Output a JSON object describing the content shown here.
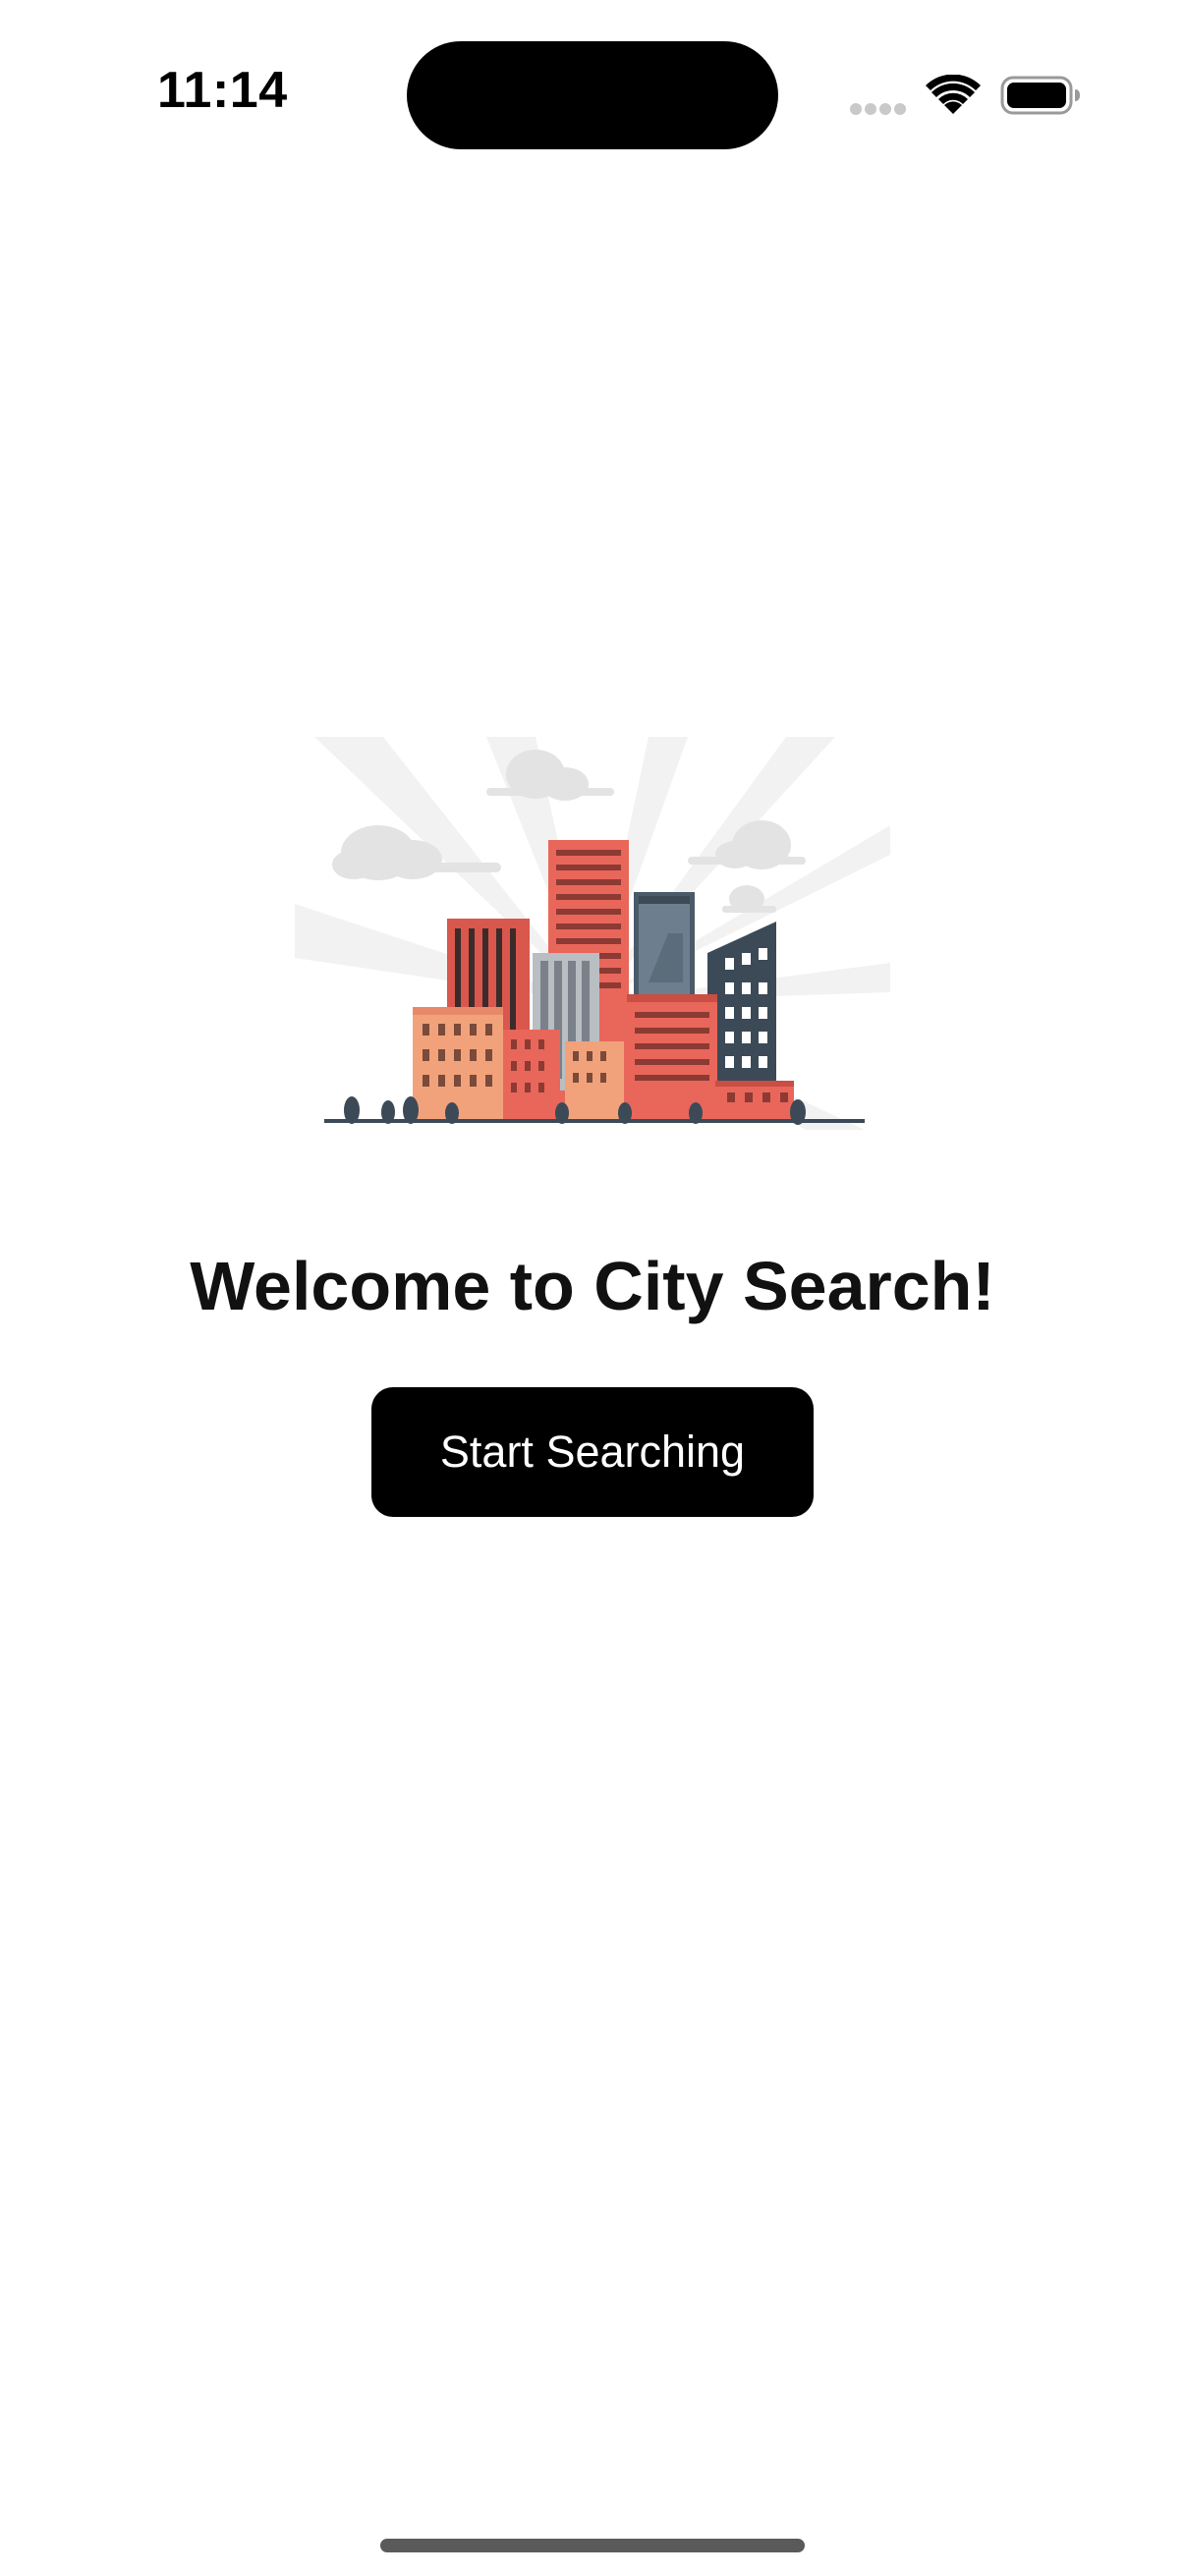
{
  "status_bar": {
    "time": "11:14"
  },
  "icons": {
    "signal": "cellular-signal-icon",
    "wifi": "wifi-icon",
    "battery": "battery-icon"
  },
  "illustration": {
    "name": "city-skyline-illustration"
  },
  "main": {
    "title": "Welcome to City Search!",
    "start_button_label": "Start Searching"
  },
  "colors": {
    "button_background": "#000000",
    "button_text": "#ffffff",
    "building_coral": "#e8675a",
    "building_peach": "#f2a27a",
    "building_slate": "#3c4a57"
  }
}
